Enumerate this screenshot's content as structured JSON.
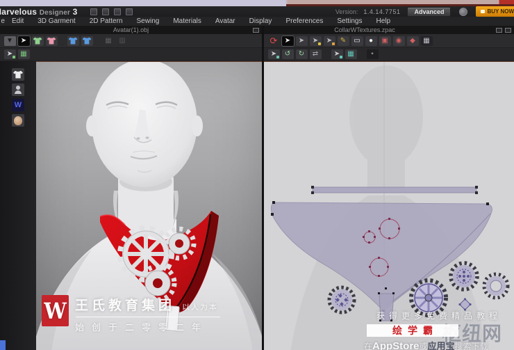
{
  "titlebar": {
    "brand_main": "Marvelous",
    "brand_sub": "Designer",
    "brand_num": "3",
    "version_label": "Version:",
    "version_value": "1.4.14.7751",
    "advanced_button": "Advanced",
    "buy_button": "BUY NOW"
  },
  "menu": {
    "clipped_first": "File",
    "items": [
      "Edit",
      "3D Garment",
      "2D Pattern",
      "Sewing",
      "Materials",
      "Avatar",
      "Display",
      "Preferences",
      "Settings",
      "Help"
    ]
  },
  "left_panel": {
    "title": "Avatar(1).obj",
    "toolbar_row1": [
      {
        "name": "display-mode-arrow-tool",
        "glyph": "▼",
        "fg": "#1c1c1e",
        "bg": "#5e5e62"
      },
      {
        "name": "select-move-tool",
        "glyph": "➤",
        "fg": "#ededef",
        "active": true
      },
      {
        "name": "select-garment-green-tool",
        "shirt": "#8fd08f"
      },
      {
        "name": "select-garment-pink-tool",
        "shirt": "#e89aab"
      },
      {
        "spacer": true
      },
      {
        "name": "show-garment-blue-tool",
        "shirt": "#5a9ae0"
      },
      {
        "name": "show-garment-blue-2-tool",
        "shirt": "#5a9ae0"
      },
      {
        "spacer": true
      },
      {
        "name": "disabled-tool-1",
        "glyph": "▦",
        "fg": "#5c5c60",
        "flat": true
      },
      {
        "name": "disabled-tool-2",
        "glyph": "▥",
        "fg": "#55555a",
        "flat": true
      }
    ],
    "toolbar_row2": [
      {
        "name": "select-avatar-tool",
        "glyph": "➤",
        "fg": "#d8d8da",
        "dot": "#7ac87a"
      },
      {
        "name": "avatar-tape-tool",
        "glyph": "▦",
        "fg": "#7ac87a"
      }
    ],
    "thumbs": [
      {
        "name": "avatar-preset-garment",
        "type": "shirt"
      },
      {
        "name": "avatar-preset-bust",
        "type": "bust"
      },
      {
        "name": "avatar-preset-crown",
        "type": "crown",
        "glyph": "W"
      },
      {
        "name": "avatar-preset-head",
        "type": "head"
      }
    ]
  },
  "right_panel": {
    "title": "CollarWTextures.zpac",
    "toolbar_row1": [
      {
        "name": "sync-2d-3d-tool",
        "glyph": "⟳",
        "fg": "#e04848",
        "flat": true,
        "size": 13
      },
      {
        "name": "transform-pattern-tool",
        "glyph": "➤",
        "fg": "#ededef",
        "active": true
      },
      {
        "name": "edit-pattern-tool",
        "glyph": "➤",
        "fg": "#bcbcbe"
      },
      {
        "name": "edit-curve-tool",
        "glyph": "➤",
        "fg": "#bcbcbe",
        "dot": "#d8c040"
      },
      {
        "name": "add-point-tool",
        "glyph": "➤",
        "fg": "#bcbcbe",
        "dot": "#e0a040"
      },
      {
        "name": "pen-polygon-tool",
        "glyph": "✎",
        "fg": "#d8b040"
      },
      {
        "name": "rectangle-tool",
        "glyph": "▭",
        "fg": "#f0f0f2"
      },
      {
        "name": "circle-tool",
        "glyph": "●",
        "fg": "#f0f0f2"
      },
      {
        "name": "internal-rectangle-tool",
        "glyph": "▣",
        "fg": "#d06060"
      },
      {
        "name": "internal-circle-tool",
        "glyph": "◉",
        "fg": "#d06060"
      },
      {
        "name": "dart-tool",
        "glyph": "◆",
        "fg": "#d06060"
      },
      {
        "name": "texture-swatch-tool",
        "glyph": "▦",
        "fg": "#c0c0c8",
        "bg": "#242428"
      }
    ],
    "toolbar_row2": [
      {
        "name": "pattern-move-tool",
        "glyph": "➤",
        "fg": "#cccccf",
        "dot": "#70c0b0"
      },
      {
        "name": "rotate-ccw-tool",
        "glyph": "↺",
        "fg": "#9ad0a0"
      },
      {
        "name": "rotate-cw-tool",
        "glyph": "↻",
        "fg": "#9ad0a0"
      },
      {
        "name": "flip-pattern-tool",
        "glyph": "⇄",
        "fg": "#aaaaac"
      },
      {
        "spacer": true
      },
      {
        "name": "segment-sewing-tool",
        "glyph": "➤",
        "fg": "#cccccf",
        "dot": "#60c8b8"
      },
      {
        "name": "free-sewing-tool",
        "glyph": "▦",
        "fg": "#60c8b8"
      },
      {
        "spacer": true
      },
      {
        "name": "measure-tool",
        "glyph": "▪",
        "fg": "#88888a",
        "bg": "#1e1e20"
      }
    ]
  },
  "watermarks": {
    "left": {
      "logo_letter": "W",
      "company": "王氏教育集团",
      "tagline": "以人为本",
      "founded": "始创于二零零二年"
    },
    "right": {
      "promo": "获得更多免费精品教程",
      "brand_red": "绘学霸",
      "brand_gray": "枢纽网",
      "dl_pre": "在",
      "dl_store": "AppStore",
      "dl_mid": "或",
      "dl_app": "应用宝",
      "dl_suf": "搜索下载"
    }
  },
  "colors": {
    "buy_orange": "#e89b12",
    "collar_red": "#c31017",
    "pattern_lavender": "#a8a4be",
    "logo_red": "#c5242b",
    "brand_red_text": "#cc1f24",
    "brand_gray_text": "#979aa4"
  }
}
